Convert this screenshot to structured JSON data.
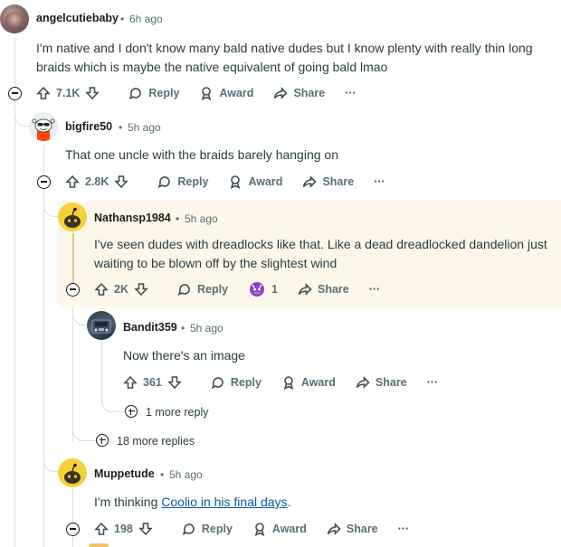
{
  "comments": [
    {
      "author": "angelcutiebaby",
      "sep": "•",
      "time": "6h ago",
      "text": "I'm native and I don't know many bald native dudes but I know plenty with really thin long braids which is maybe the native equivalent of going bald lmao",
      "votes": "7.1K",
      "reply": "Reply",
      "award": "Award",
      "share": "Share",
      "overflow": "···"
    },
    {
      "author": "bigfire50",
      "sep": "•",
      "time": "5h ago",
      "text": "That one uncle with the braids barely hanging on",
      "votes": "2.8K",
      "reply": "Reply",
      "award": "Award",
      "share": "Share",
      "overflow": "···"
    },
    {
      "author": "Nathansp1984",
      "sep": "•",
      "time": "5h ago",
      "text": "I've seen dudes with dreadlocks like that. Like a dead dreadlocked dandelion just waiting to be blown off by the slightest wind",
      "votes": "2K",
      "reply": "Reply",
      "award_count": "1",
      "share": "Share",
      "overflow": "···"
    },
    {
      "author": "Bandit359",
      "sep": "•",
      "time": "5h ago",
      "text": "Now there's an image",
      "votes": "361",
      "reply": "Reply",
      "award": "Award",
      "share": "Share",
      "overflow": "···"
    },
    {
      "author": "Muppetude",
      "sep": "•",
      "time": "5h ago",
      "text_prefix": "I'm thinking ",
      "link_text": "Coolio in his final days",
      "text_suffix": ".",
      "votes": "198",
      "reply": "Reply",
      "award": "Award",
      "share": "Share",
      "overflow": "···"
    }
  ],
  "more_replies_bandit": "1 more reply",
  "more_replies_nathan": "18 more replies",
  "colors": {
    "highlight_bg": "#fcf7e8",
    "link": "#0a5aa8",
    "meta": "#576f76",
    "snoo_orange": "#ff4500",
    "snoo_yellow": "#f5d03b"
  }
}
